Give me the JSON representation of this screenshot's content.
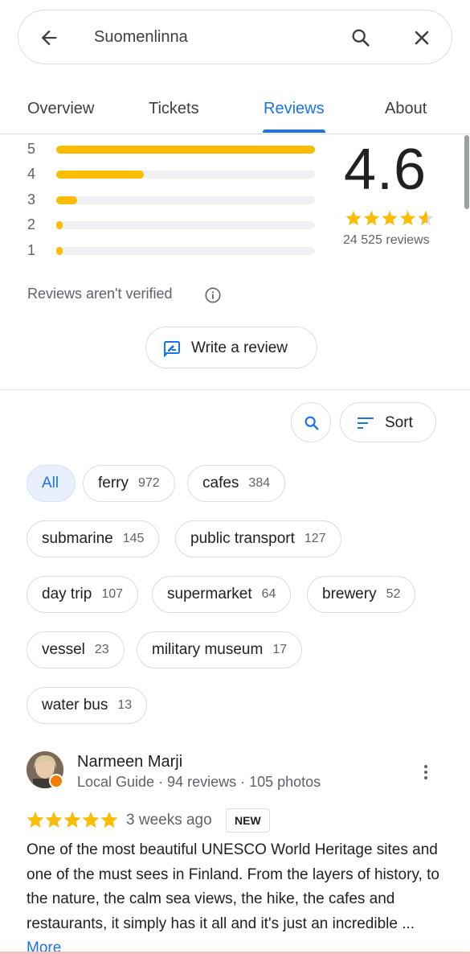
{
  "search": {
    "query": "Suomenlinna"
  },
  "tabs": [
    {
      "label": "Overview"
    },
    {
      "label": "Tickets"
    },
    {
      "label": "Reviews",
      "active": true
    },
    {
      "label": "About"
    }
  ],
  "ratings": {
    "distribution": [
      {
        "stars": "5",
        "fraction": 1.0
      },
      {
        "stars": "4",
        "fraction": 0.34
      },
      {
        "stars": "3",
        "fraction": 0.08
      },
      {
        "stars": "2",
        "fraction": 0.02
      },
      {
        "stars": "1",
        "fraction": 0.02
      }
    ],
    "average": "4.6",
    "count_text": "24 525 reviews",
    "star_fill": 4.6
  },
  "notice": {
    "text": "Reviews aren't verified"
  },
  "write_review": {
    "label": "Write a review"
  },
  "sort": {
    "label": "Sort"
  },
  "chips": [
    {
      "label": "All",
      "count": "",
      "active": true
    },
    {
      "label": "ferry",
      "count": "972"
    },
    {
      "label": "cafes",
      "count": "384"
    },
    {
      "label": "submarine",
      "count": "145"
    },
    {
      "label": "public transport",
      "count": "127"
    },
    {
      "label": "day trip",
      "count": "107"
    },
    {
      "label": "supermarket",
      "count": "64"
    },
    {
      "label": "brewery",
      "count": "52"
    },
    {
      "label": "vessel",
      "count": "23"
    },
    {
      "label": "military museum",
      "count": "17"
    },
    {
      "label": "water bus",
      "count": "13"
    }
  ],
  "review": {
    "name": "Narmeen Marji",
    "meta": "Local Guide · 94 reviews · 105 photos",
    "stars": 5,
    "date": "3 weeks ago",
    "badge": "NEW",
    "text": "One of the most beautiful UNESCO World Heritage sites and one of the must sees in Finland. From the layers of history, to the nature, the calm sea views, the hike, the cafes and restaurants, it simply has it all and it's just an incredible ... ",
    "more_label": "More"
  },
  "colors": {
    "accent": "#1a73e8",
    "star": "#fbbc04",
    "chip_active_bg": "#e8f0fe"
  }
}
